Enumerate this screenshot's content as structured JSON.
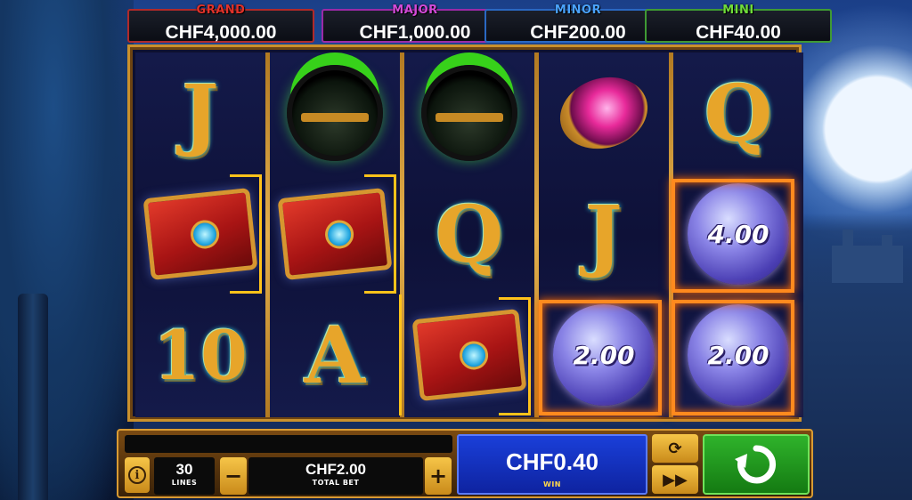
{
  "jackpots": [
    {
      "name": "GRAND",
      "value": "CHF4,000.00",
      "color": "#e0322a"
    },
    {
      "name": "MAJOR",
      "value": "CHF1,000.00",
      "color": "#d24ad8"
    },
    {
      "name": "MINOR",
      "value": "CHF200.00",
      "color": "#4aa3ff"
    },
    {
      "name": "MINI",
      "value": "CHF40.00",
      "color": "#6fdc3a"
    }
  ],
  "reels": [
    [
      "J",
      "cauldron",
      "spellbook"
    ],
    [
      "cauldron",
      "spellbook",
      "A"
    ],
    [
      "cauldron",
      "Q",
      "spellbook"
    ],
    [
      "ruby-ring",
      "J",
      "orb"
    ],
    [
      "Q",
      "orb",
      "orb"
    ]
  ],
  "reel_letters": {
    "reel1_top": "J",
    "reel1_bottom": "10",
    "reel2_bottom": "A",
    "reel3_middle": "Q",
    "reel4_middle": "J",
    "reel5_top": "Q"
  },
  "orb_values": {
    "reel5_middle": "4.00",
    "reel4_bottom": "2.00",
    "reel5_bottom": "2.00"
  },
  "controls": {
    "lines_value": "30",
    "lines_label": "LINES",
    "bet_value": "CHF2.00",
    "bet_label": "TOTAL BET",
    "minus_label": "−",
    "plus_label": "+",
    "win_value": "CHF0.40",
    "win_label": "WIN",
    "info_label": "i",
    "autoplay_icon": "⟳",
    "turbo_icon": "▶▶"
  },
  "colors": {
    "frame_gold": "#c9902c",
    "win_orange": "#ff8a1e",
    "spin_green": "#2fb32b",
    "win_blue": "#1a3fd9"
  }
}
